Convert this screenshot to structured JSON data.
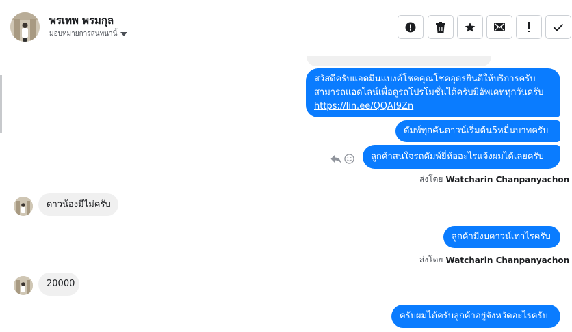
{
  "header": {
    "contact_name": "พรเทพ พรมกุล",
    "assign_label": "มอบหมายการสนทนานี้",
    "actions": [
      {
        "name": "spam-button",
        "icon": "alert-circle-icon"
      },
      {
        "name": "delete-button",
        "icon": "trash-icon"
      },
      {
        "name": "star-button",
        "icon": "star-icon"
      },
      {
        "name": "mark-unread-button",
        "icon": "envelope-icon"
      },
      {
        "name": "follow-up-button",
        "icon": "exclamation-icon"
      },
      {
        "name": "done-button",
        "icon": "checkmark-icon"
      }
    ]
  },
  "messages": {
    "m1_line1": "สวัสดีครับแอดมินแบงค์โชคคุณโชคอุดรยินดีให้บริการครับ",
    "m1_line2": "สามารถแอดไลน์เพื่อดูรถโปรโมชั่นได้ครับมีอัพเดททุกวันครับ",
    "m1_link": "https://lin.ee/QQAI9Zn",
    "m2": "ดัมพ์ทุกคันดาวน์เริ่มต้น5หมื่นบาทครับ",
    "m3": "ลูกค้าสนใจรถดัมพ์ยี่ห้ออะไรแจ้งผมได้เลยครับ",
    "m4": "ดาวน้องมีไม่ครับ",
    "m5": "ลูกค้ามีงบดาวน์เท่าไรครับ",
    "m6": "20000",
    "m7": "ครับผมได้ครับลูกค้าอยู่จังหวัดอะไรครับ"
  },
  "sent_by": {
    "prefix": "ส่งโดย",
    "agent": "Watcharin Chanpanyachon",
    "info": "?"
  },
  "colors": {
    "outgoing": "#0a7cff",
    "incoming": "#f0f0f0",
    "border": "#dcdfe3"
  }
}
